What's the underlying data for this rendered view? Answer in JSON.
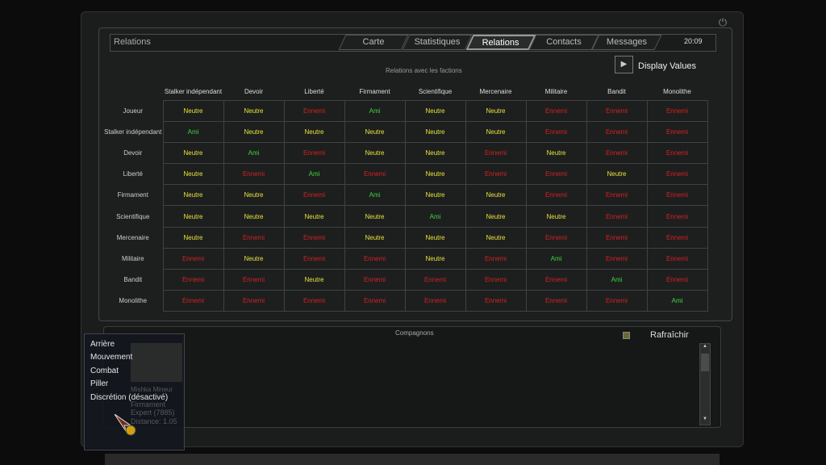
{
  "header": {
    "title": "Relations",
    "clock": "20:09",
    "tabs": [
      {
        "label": "Carte"
      },
      {
        "label": "Statistiques"
      },
      {
        "label": "Relations",
        "active": true
      },
      {
        "label": "Contacts"
      },
      {
        "label": "Messages"
      }
    ]
  },
  "relations": {
    "subtitle": "Relations avec les factions",
    "display_values_label": "Display Values",
    "columns": [
      "Stalker  indépendant",
      "Devoir",
      "Liberté",
      "Firmament",
      "Scientifique",
      "Mercenaire",
      "Militaire",
      "Bandit",
      "Monolithe"
    ],
    "rows": [
      {
        "label": "Joueur",
        "values": [
          "Neutre",
          "Neutre",
          "Ennemi",
          "Ami",
          "Neutre",
          "Neutre",
          "Ennemi",
          "Ennemi",
          "Ennemi"
        ]
      },
      {
        "label": "Stalker  indépendant",
        "values": [
          "Ami",
          "Neutre",
          "Neutre",
          "Neutre",
          "Neutre",
          "Neutre",
          "Ennemi",
          "Ennemi",
          "Ennemi"
        ]
      },
      {
        "label": "Devoir",
        "values": [
          "Neutre",
          "Ami",
          "Ennemi",
          "Neutre",
          "Neutre",
          "Ennemi",
          "Neutre",
          "Ennemi",
          "Ennemi"
        ]
      },
      {
        "label": "Liberté",
        "values": [
          "Neutre",
          "Ennemi",
          "Ami",
          "Ennemi",
          "Neutre",
          "Ennemi",
          "Ennemi",
          "Neutre",
          "Ennemi"
        ]
      },
      {
        "label": "Firmament",
        "values": [
          "Neutre",
          "Neutre",
          "Ennemi",
          "Ami",
          "Neutre",
          "Neutre",
          "Ennemi",
          "Ennemi",
          "Ennemi"
        ]
      },
      {
        "label": "Scientifique",
        "values": [
          "Neutre",
          "Neutre",
          "Neutre",
          "Neutre",
          "Ami",
          "Neutre",
          "Neutre",
          "Ennemi",
          "Ennemi"
        ]
      },
      {
        "label": "Mercenaire",
        "values": [
          "Neutre",
          "Ennemi",
          "Ennemi",
          "Neutre",
          "Neutre",
          "Neutre",
          "Ennemi",
          "Ennemi",
          "Ennemi"
        ]
      },
      {
        "label": "Militaire",
        "values": [
          "Ennemi",
          "Neutre",
          "Ennemi",
          "Ennemi",
          "Neutre",
          "Ennemi",
          "Ami",
          "Ennemi",
          "Ennemi"
        ]
      },
      {
        "label": "Bandit",
        "values": [
          "Ennemi",
          "Ennemi",
          "Neutre",
          "Ennemi",
          "Ennemi",
          "Ennemi",
          "Ennemi",
          "Ami",
          "Ennemi"
        ]
      },
      {
        "label": "Monolithe",
        "values": [
          "Ennemi",
          "Ennemi",
          "Ennemi",
          "Ennemi",
          "Ennemi",
          "Ennemi",
          "Ennemi",
          "Ennemi",
          "Ami"
        ]
      }
    ],
    "colors": {
      "Neutre": "#e6e23a",
      "Ennemi": "#d42020",
      "Ami": "#3cd43c"
    }
  },
  "companions": {
    "title": "Compagnons",
    "refresh_label": "Rafraîchir",
    "name": "Mishka  Mineur",
    "faction": "Firmament",
    "rank": "Expert  (7885)",
    "distance": "Distance:  1.05"
  },
  "context_menu": {
    "items": [
      "Arrière",
      "Mouvement",
      "Combat",
      "Piller",
      "Discrétion  (désactivé)"
    ]
  }
}
